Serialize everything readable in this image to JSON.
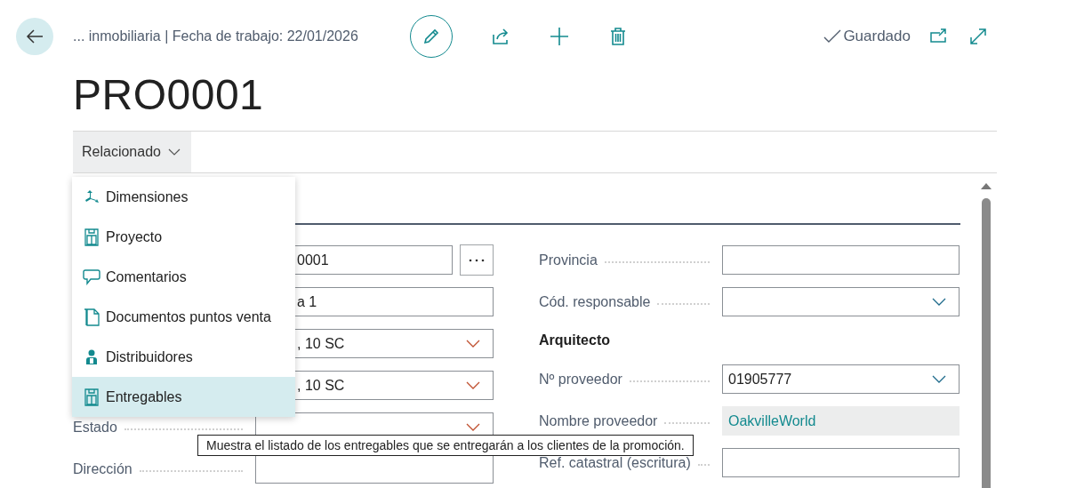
{
  "header": {
    "breadcrumb": "... inmobiliaria | Fecha de trabajo: 22/01/2026",
    "status": "Guardado"
  },
  "title": "PRO0001",
  "action_bar": {
    "button": "Relacionado",
    "expanded": true
  },
  "menu": {
    "items": [
      {
        "label": "Dimensiones",
        "selected": false
      },
      {
        "label": "Proyecto",
        "selected": false
      },
      {
        "label": "Comentarios",
        "selected": false
      },
      {
        "label": "Documentos puntos venta",
        "selected": false
      },
      {
        "label": "Distribuidores",
        "selected": false
      },
      {
        "label": "Entregables",
        "selected": true
      }
    ]
  },
  "tooltip": "Muestra el listado de los entregables que se entregarán a los clientes de la promoción.",
  "form": {
    "left": [
      {
        "kind": "lookup",
        "value": "0001"
      },
      {
        "kind": "text",
        "value": "a 1"
      },
      {
        "kind": "select",
        "value": ", 10 SC"
      },
      {
        "kind": "select",
        "value": ", 10 SC"
      },
      {
        "kind": "select",
        "label": "Estado"
      },
      {
        "kind": "text",
        "label": "Dirección"
      }
    ],
    "right": [
      {
        "kind": "text",
        "label": "Provincia"
      },
      {
        "kind": "select",
        "label": "Cód. responsable"
      },
      {
        "kind": "heading",
        "label": "Arquitecto"
      },
      {
        "kind": "select",
        "label": "Nº proveedor",
        "value": "01905777"
      },
      {
        "kind": "readonly",
        "label": "Nombre proveedor",
        "value": "OakvilleWorld"
      },
      {
        "kind": "text",
        "label": "Ref. catastral (escritura)"
      }
    ]
  }
}
